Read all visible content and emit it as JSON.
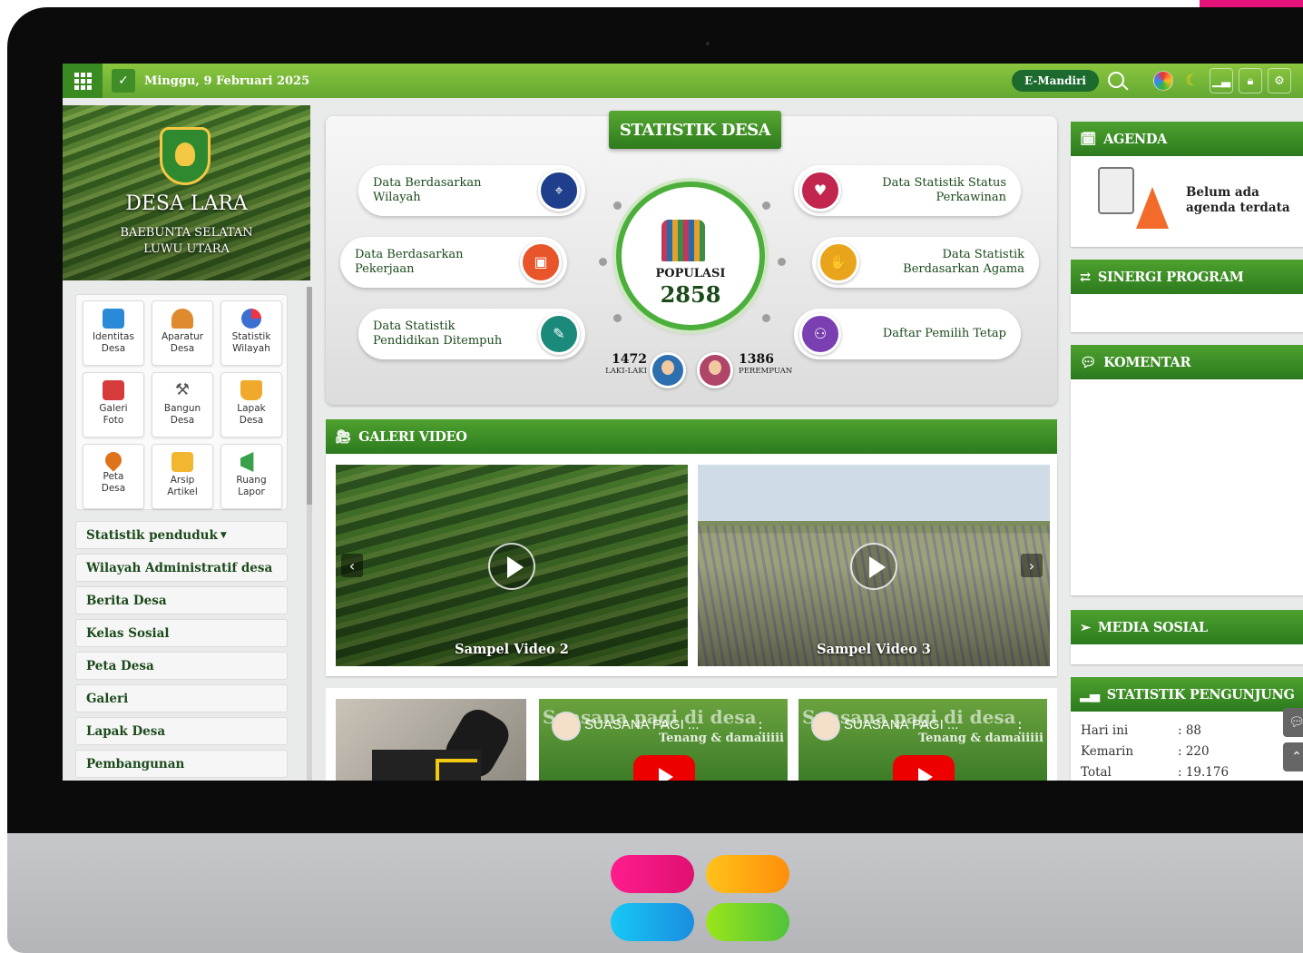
{
  "topbar": {
    "date": "Minggu, 9 Februari 2025",
    "emandiri": "E-Mandiri"
  },
  "hero": {
    "village": "DESA LARA",
    "district": "BAEBUNTA SELATAN",
    "regency": "LUWU UTARA"
  },
  "tiles": [
    {
      "line1": "Identitas",
      "line2": "Desa",
      "color": "#2a8ad8"
    },
    {
      "line1": "Aparatur",
      "line2": "Desa",
      "color": "#e08a2e"
    },
    {
      "line1": "Statistik",
      "line2": "Wilayah",
      "color": "#3b6fd0"
    },
    {
      "line1": "Galeri",
      "line2": "Foto",
      "color": "#d63a3a"
    },
    {
      "line1": "Bangun",
      "line2": "Desa",
      "color": "#555555"
    },
    {
      "line1": "Lapak",
      "line2": "Desa",
      "color": "#f0a92a"
    },
    {
      "line1": "Peta",
      "line2": "Desa",
      "color": "#e0721a"
    },
    {
      "line1": "Arsip",
      "line2": "Artikel",
      "color": "#f2b630"
    },
    {
      "line1": "Ruang",
      "line2": "Lapor",
      "color": "#3aa04a"
    }
  ],
  "menu": [
    "Statistik penduduk",
    "Wilayah Administratif desa",
    "Berita Desa",
    "Kelas Sosial",
    "Peta Desa",
    "Galeri",
    "Lapak Desa",
    "Pembangunan"
  ],
  "stat": {
    "title": "STATISTIK DESA",
    "left": [
      {
        "l1": "Data Berdasarkan",
        "l2": "Wilayah",
        "color": "#1f3f8c"
      },
      {
        "l1": "Data Berdasarkan",
        "l2": "Pekerjaan",
        "color": "#e8552a"
      },
      {
        "l1": "Data Statistik",
        "l2": "Pendidikan Ditempuh",
        "color": "#1b8a7a"
      }
    ],
    "right": [
      {
        "l1": "Data Statistik Status",
        "l2": "Perkawinan",
        "color": "#c2264f"
      },
      {
        "l1": "Data Statistik",
        "l2": "Berdasarkan Agama",
        "color": "#e8a51c"
      },
      {
        "l1": "Daftar Pemilih Tetap",
        "l2": "",
        "color": "#7a3fb0"
      }
    ],
    "pop_label": "POPULASI",
    "pop_total": "2858",
    "male_count": "1472",
    "male_label": "LAKI-LAKI",
    "female_count": "1386",
    "female_label": "PEREMPUAN"
  },
  "galeri": {
    "title": "GALERI VIDEO",
    "videos": [
      "Sampel Video 2",
      "Sampel Video 3"
    ],
    "yt_title": "SUASANA PAGI ...",
    "yt_overlay": "Suasana pagi di desa",
    "yt_sub": "Tenang & damaiiiii"
  },
  "right": {
    "agenda_title": "AGENDA",
    "agenda_empty_l1": "Belum ada",
    "agenda_empty_l2": "agenda terdata",
    "sinergi_title": "SINERGI PROGRAM",
    "komentar_title": "KOMENTAR",
    "media_title": "MEDIA SOSIAL",
    "pengunjung_title": "STATISTIK PENGUNJUNG",
    "visitors": [
      {
        "label": "Hari ini",
        "value": ": 88"
      },
      {
        "label": "Kemarin",
        "value": ": 220"
      },
      {
        "label": "Total",
        "value": ": 19.176"
      }
    ]
  },
  "brand_colors": {
    "accent": "#4caf3c",
    "dark_green": "#2c7a1e",
    "pink": "#e6137a"
  }
}
